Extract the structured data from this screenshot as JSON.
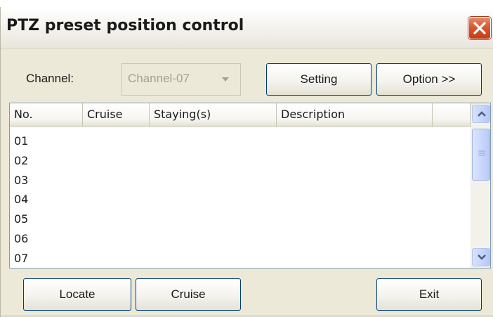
{
  "window": {
    "title": "PTZ preset position control"
  },
  "channel": {
    "label": "Channel:",
    "value": "Channel-07"
  },
  "buttons": {
    "setting": "Setting",
    "option": "Option >>",
    "locate": "Locate",
    "cruise": "Cruise",
    "exit": "Exit"
  },
  "list": {
    "columns": [
      "No.",
      "Cruise",
      "Staying(s)",
      "Description",
      ""
    ],
    "rows": [
      "01",
      "02",
      "03",
      "04",
      "05",
      "06",
      "07"
    ]
  },
  "icons": {
    "close": "close-icon",
    "dropdown": "chevron-down-icon",
    "scroll_up": "chevron-up-icon",
    "scroll_down": "chevron-down-icon",
    "grip": "grip-icon"
  },
  "colors": {
    "dialog_bg": "#ece9d8",
    "close_button": "#d9542e",
    "list_border": "#7f9db9",
    "button_border": "#003c74",
    "scrollbar": "#c3d3fd"
  }
}
